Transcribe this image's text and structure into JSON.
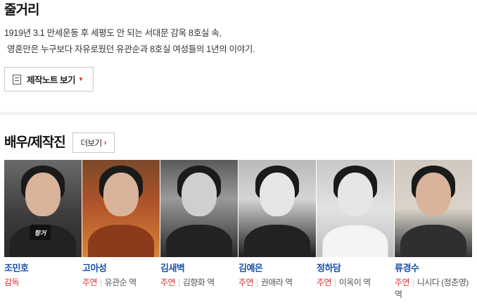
{
  "synopsis": {
    "title": "줄거리",
    "lines": [
      "1919년 3.1 만세운동 후 세평도 안 되는 서대문 감옥 8호실 속,",
      "영혼만은 누구보다 자유로웠던 유관순과 8호실 여성들의 1년의 이야기."
    ],
    "note_button": "제작노트 보기",
    "note_icon": "document-icon",
    "caret_icon": "caret-down-icon"
  },
  "cast": {
    "title": "배우/제작진",
    "more_button": "더보기",
    "more_icon": "chevron-right-icon",
    "members": [
      {
        "name": "조민호",
        "role": "감독",
        "character": "",
        "mic_text": "항거"
      },
      {
        "name": "고아성",
        "role": "주연",
        "character": "유관순 역"
      },
      {
        "name": "김새벽",
        "role": "주연",
        "character": "김향화 역"
      },
      {
        "name": "김예은",
        "role": "주연",
        "character": "권애라 역"
      },
      {
        "name": "정하담",
        "role": "주연",
        "character": "이옥이 역"
      },
      {
        "name": "류경수",
        "role": "주연",
        "character": "니시다 (정춘영) 역"
      }
    ]
  },
  "colors": {
    "name_link": "#1a4fa8",
    "role_accent": "#e03030",
    "divider": "#f0f0f0"
  }
}
